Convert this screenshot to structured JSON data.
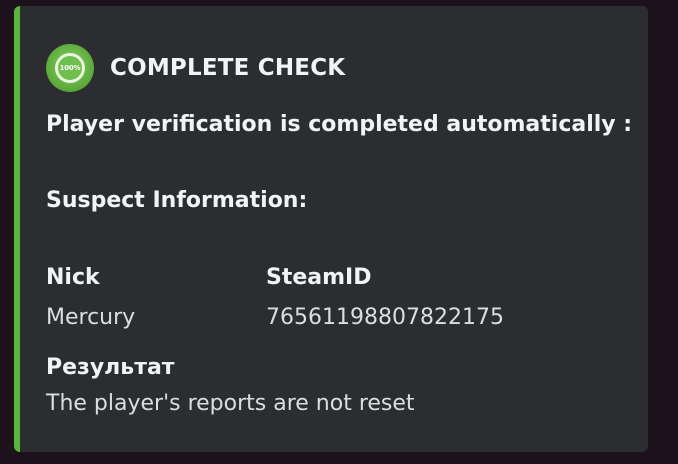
{
  "embed": {
    "accent_color": "#5ab53b",
    "author": {
      "icon": "check-badge-icon",
      "icon_text": "100%",
      "name": "COMPLETE CHECK"
    },
    "description": "Player verification is completed automatically :",
    "suspect_heading": "Suspect Information:",
    "fields": {
      "nick": {
        "name": "Nick",
        "value": "Mercury"
      },
      "steamid": {
        "name": "SteamID",
        "value": "76561198807822175"
      },
      "result": {
        "name": "Результат",
        "value": "The player's reports are not reset"
      }
    }
  }
}
